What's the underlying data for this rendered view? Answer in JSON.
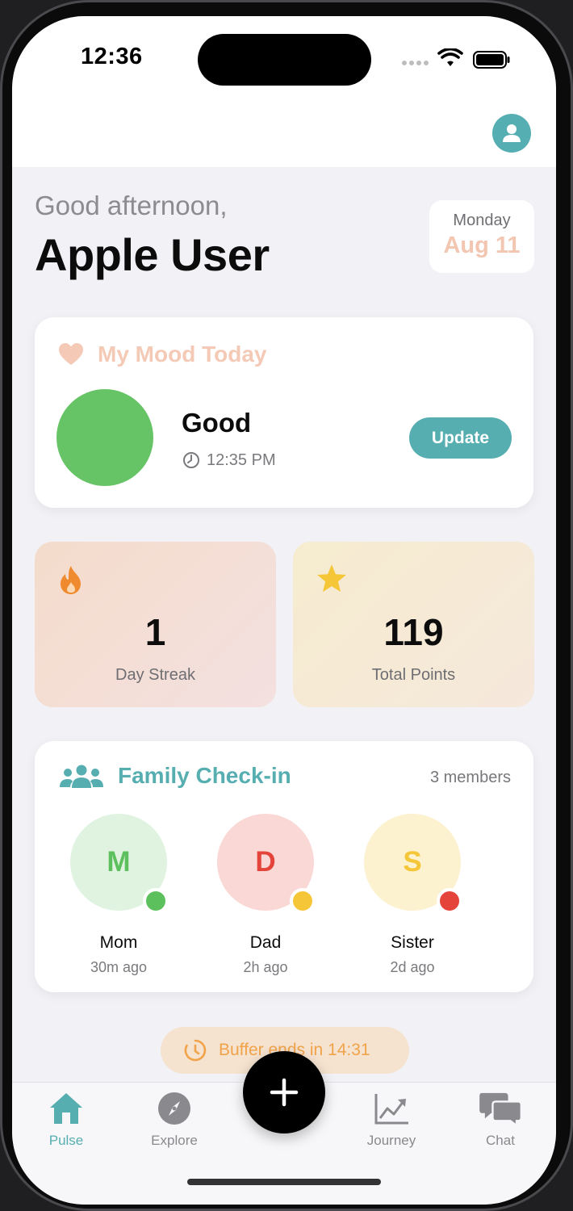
{
  "status_bar": {
    "time": "12:36"
  },
  "header": {
    "profile_icon": "person-icon"
  },
  "greeting": {
    "line1": "Good afternoon,",
    "name": "Apple User"
  },
  "date_card": {
    "day": "Monday",
    "date": "Aug 11"
  },
  "mood": {
    "title": "My Mood Today",
    "icon": "heart-icon",
    "value": "Good",
    "time": "12:35 PM",
    "color": "#66c466",
    "update_label": "Update"
  },
  "stats": [
    {
      "icon": "flame-icon",
      "value": "1",
      "label": "Day Streak"
    },
    {
      "icon": "star-icon",
      "value": "119",
      "label": "Total Points"
    }
  ],
  "family": {
    "title": "Family Check-in",
    "count": "3 members",
    "members": [
      {
        "initial": "M",
        "name": "Mom",
        "time": "30m ago",
        "status_color": "#5cc05c"
      },
      {
        "initial": "D",
        "name": "Dad",
        "time": "2h ago",
        "status_color": "#f5c637"
      },
      {
        "initial": "S",
        "name": "Sister",
        "time": "2d ago",
        "status_color": "#e4443a"
      }
    ]
  },
  "buffer": {
    "text": "Buffer ends in 14:31"
  },
  "tabs": [
    {
      "label": "Pulse",
      "icon": "house-icon",
      "active": true
    },
    {
      "label": "Explore",
      "icon": "compass-icon",
      "active": false
    },
    {
      "label": "Journey",
      "icon": "chart-icon",
      "active": false
    },
    {
      "label": "Chat",
      "icon": "chat-bubbles-icon",
      "active": false
    }
  ],
  "fab": {
    "icon": "plus-icon"
  },
  "colors": {
    "accent": "#56aeb0",
    "background": "#f2f2f6"
  }
}
